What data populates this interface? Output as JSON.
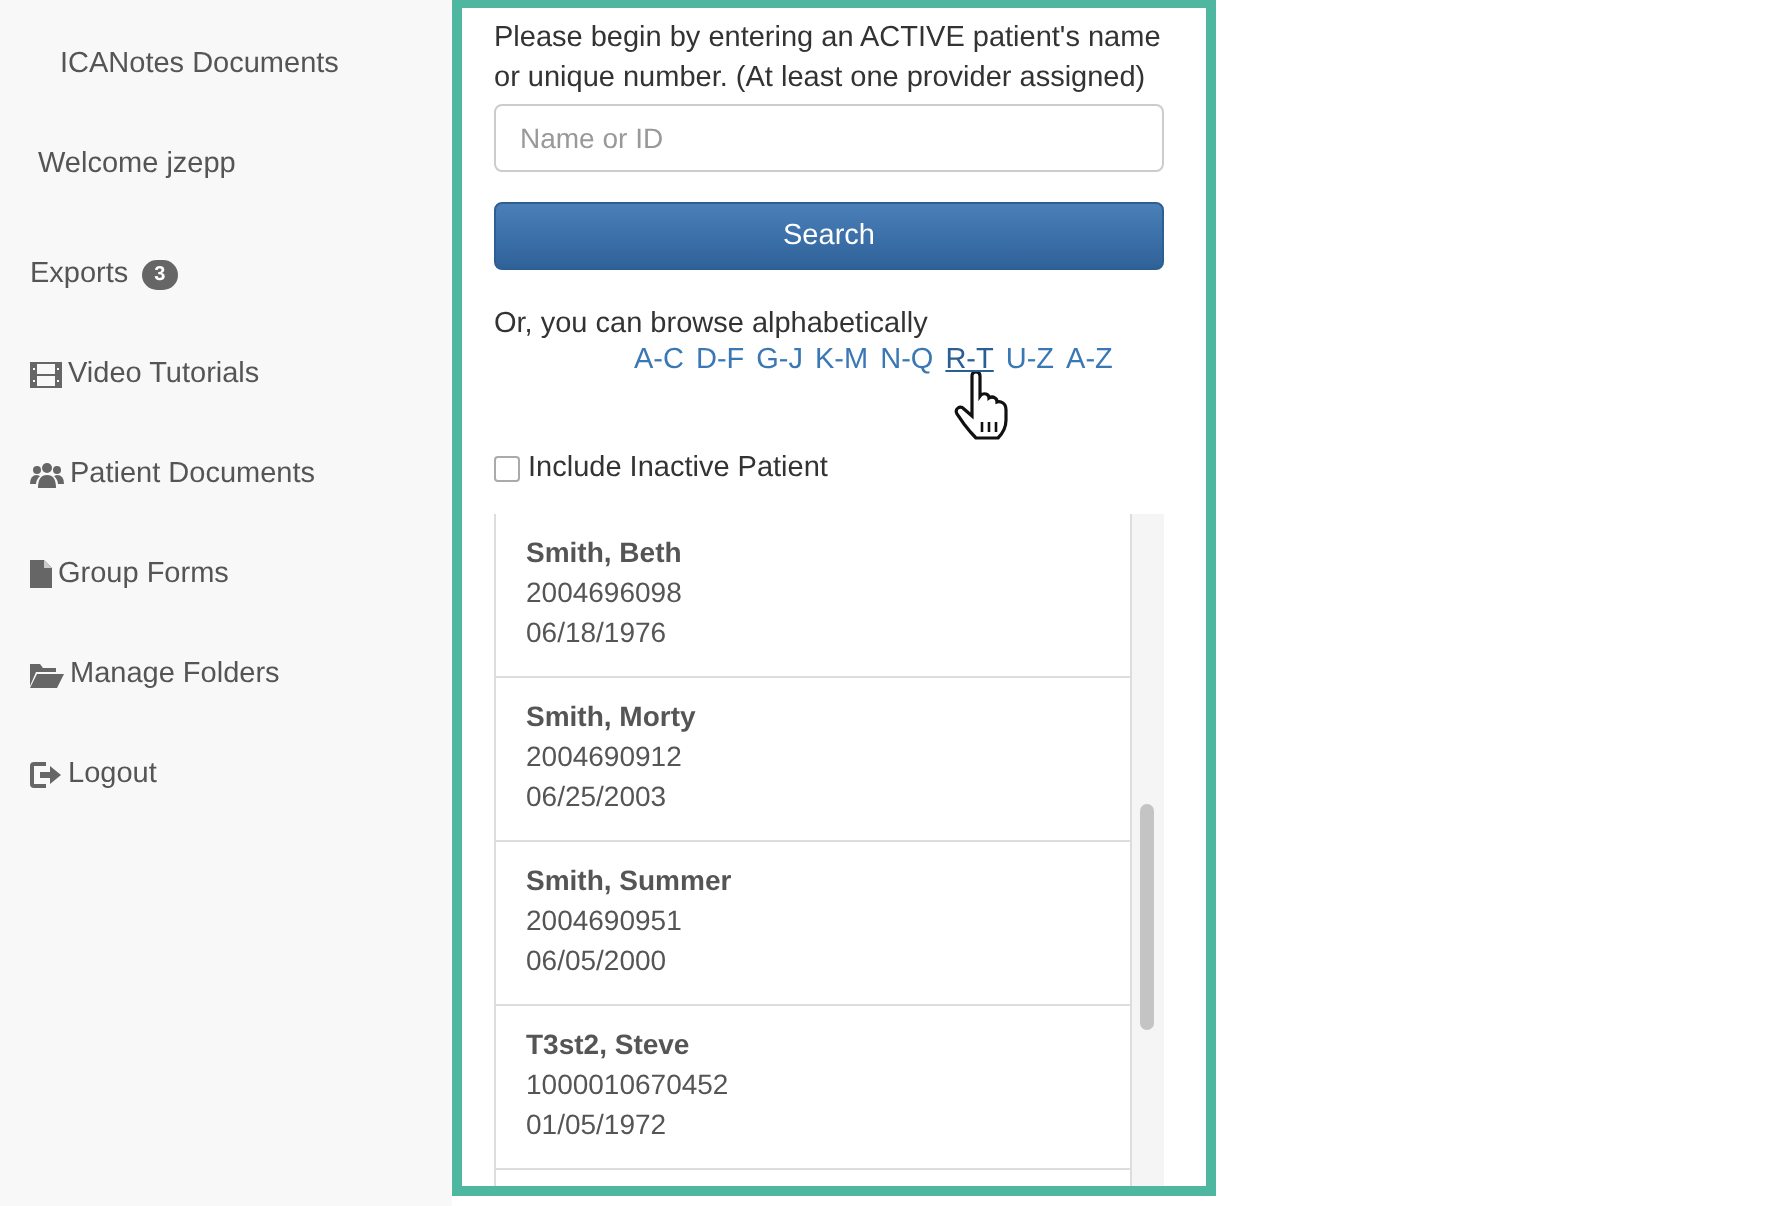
{
  "sidebar": {
    "title": "ICANotes Documents",
    "welcome": "Welcome jzepp",
    "items": [
      {
        "label": "Exports",
        "kind": "badged",
        "badge": "3"
      },
      {
        "label": "Video Tutorials",
        "kind": "film"
      },
      {
        "label": "Patient Documents",
        "kind": "users"
      },
      {
        "label": "Group Forms",
        "kind": "file"
      },
      {
        "label": "Manage Folders",
        "kind": "folder"
      },
      {
        "label": "Logout",
        "kind": "logout"
      }
    ]
  },
  "search": {
    "instructions": "Please begin by entering an ACTIVE patient's name or unique number. (At least one provider assigned)",
    "placeholder": "Name or ID",
    "button": "Search"
  },
  "browse": {
    "label": "Or, you can browse alphabetically",
    "links": [
      {
        "label": "A-C",
        "hover": false
      },
      {
        "label": "D-F",
        "hover": false
      },
      {
        "label": "G-J",
        "hover": false
      },
      {
        "label": "K-M",
        "hover": false
      },
      {
        "label": "N-Q",
        "hover": false
      },
      {
        "label": "R-T",
        "hover": true
      },
      {
        "label": "U-Z",
        "hover": false
      },
      {
        "label": "A-Z",
        "hover": false
      }
    ]
  },
  "include_inactive": {
    "label": "Include Inactive Patient",
    "checked": false
  },
  "patients": [
    {
      "name": "Smith, Beth",
      "number": "2004696098",
      "dob": "06/18/1976"
    },
    {
      "name": "Smith, Morty",
      "number": "2004690912",
      "dob": "06/25/2003"
    },
    {
      "name": "Smith, Summer",
      "number": "2004690951",
      "dob": "06/05/2000"
    },
    {
      "name": "T3st2, Steve",
      "number": "1000010670452",
      "dob": "01/05/1972"
    }
  ]
}
